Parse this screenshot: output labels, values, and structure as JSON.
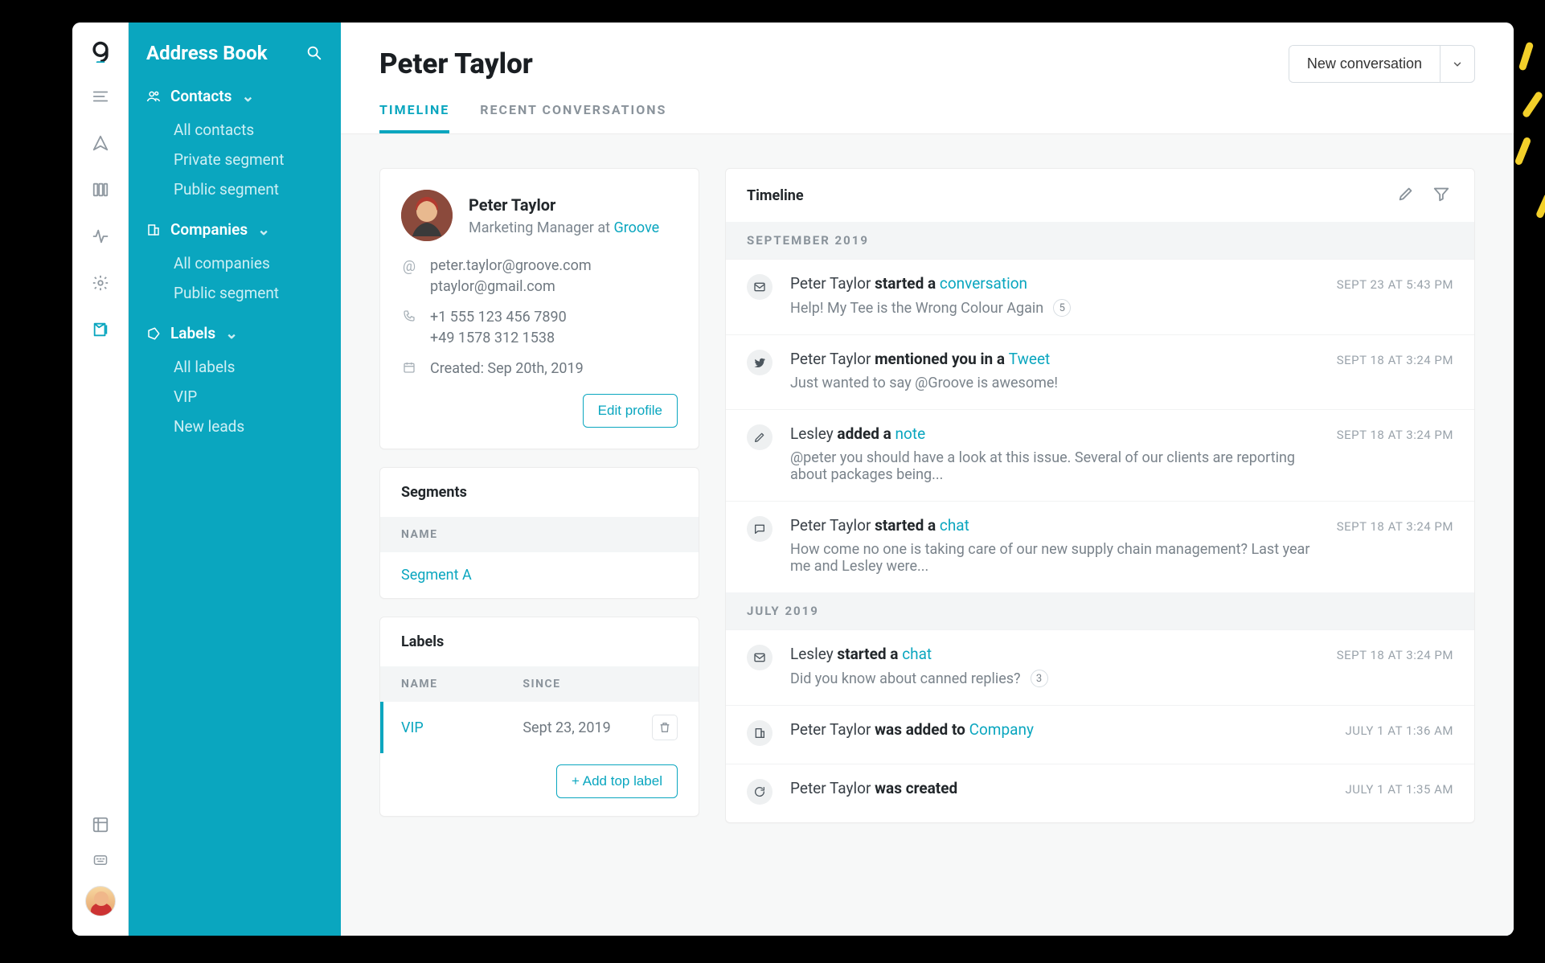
{
  "rail": {
    "logo_label": "groove-logo"
  },
  "sidebar": {
    "title": "Address Book",
    "sections": [
      {
        "label": "Contacts",
        "items": [
          "All contacts",
          "Private segment",
          "Public segment"
        ]
      },
      {
        "label": "Companies",
        "items": [
          "All companies",
          "Public segment"
        ]
      },
      {
        "label": "Labels",
        "items": [
          "All labels",
          "VIP",
          "New leads"
        ]
      }
    ]
  },
  "header": {
    "title": "Peter Taylor",
    "new_button": "New conversation"
  },
  "tabs": {
    "timeline": "Timeline",
    "recent": "Recent Conversations"
  },
  "profile": {
    "name": "Peter Taylor",
    "role_prefix": "Marketing Manager at ",
    "role_link": "Groove",
    "emails": [
      "peter.taylor@groove.com",
      "ptaylor@gmail.com"
    ],
    "phones": [
      "+1 555 123 456 7890",
      "+49 1578 312 1538"
    ],
    "created_label": "Created: ",
    "created_value": "Sep 20th, 2019",
    "edit_button": "Edit profile"
  },
  "segments": {
    "title": "Segments",
    "col_name": "NAME",
    "rows": [
      {
        "name": "Segment A"
      }
    ]
  },
  "labels_panel": {
    "title": "Labels",
    "col_name": "NAME",
    "col_since": "SINCE",
    "rows": [
      {
        "name": "VIP",
        "since": "Sept 23, 2019"
      }
    ],
    "add_button": "+ Add top label"
  },
  "timeline": {
    "title": "Timeline",
    "groups": [
      {
        "label": "SEPTEMBER 2019",
        "events": [
          {
            "icon": "mail",
            "actor": "Peter Taylor ",
            "verb": "started a ",
            "link": "conversation",
            "sub": "Help! My Tee is the Wrong Colour Again",
            "badge": "5",
            "ts": "SEPT 23 AT 5:43 PM"
          },
          {
            "icon": "twitter",
            "actor": "Peter Taylor ",
            "verb": "mentioned you in a ",
            "link": "Tweet",
            "sub": "Just wanted to say @Groove is awesome!",
            "ts": "SEPT 18 AT 3:24 PM"
          },
          {
            "icon": "pencil",
            "actor": "Lesley ",
            "verb": "added a ",
            "link": "note",
            "sub": "@peter you should have a look at this issue. Several of our clients are reporting about packages being...",
            "ts": "SEPT 18 AT 3:24 PM"
          },
          {
            "icon": "chat",
            "actor": "Peter Taylor ",
            "verb": "started a ",
            "link": "chat",
            "sub": "How come no one is taking care of our new supply chain management? Last year me and Lesley were...",
            "ts": "SEPT 18 AT 3:24 PM"
          }
        ]
      },
      {
        "label": "JULY 2019",
        "events": [
          {
            "icon": "mail",
            "actor": "Lesley ",
            "verb": "started a ",
            "link": "chat",
            "sub": "Did you know about canned replies?",
            "badge": "3",
            "ts": "SEPT 18 AT 3:24 PM"
          },
          {
            "icon": "company",
            "actor": "Peter Taylor ",
            "verb": "was added to ",
            "link": "Company",
            "ts": "JULY 1 AT 1:36 AM"
          },
          {
            "icon": "refresh",
            "actor": "Peter Taylor ",
            "verb": "was created",
            "ts": "JULY 1 AT 1:35 AM"
          }
        ]
      }
    ]
  }
}
